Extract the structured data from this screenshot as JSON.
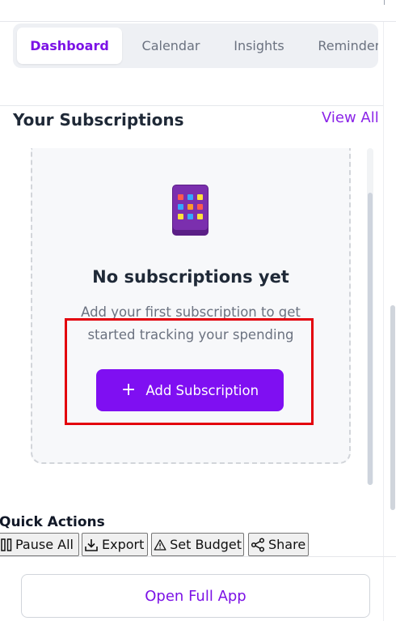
{
  "tabs": [
    {
      "label": "Dashboard",
      "active": true
    },
    {
      "label": "Calendar",
      "active": false
    },
    {
      "label": "Insights",
      "active": false
    },
    {
      "label": "Reminders",
      "active": false
    }
  ],
  "subscriptions": {
    "title": "Your Subscriptions",
    "view_all_label": "View All",
    "empty_icon": "mobile-apps-icon",
    "empty_title": "No subscriptions yet",
    "empty_description": "Add your first subscription to get started tracking your spending",
    "add_button_label": "Add Subscription",
    "add_button_icon": "plus-icon"
  },
  "quick_actions": {
    "title": "Quick Actions",
    "buttons": [
      {
        "label": "Pause All",
        "icon": "pause-icon"
      },
      {
        "label": "Export",
        "icon": "download-icon"
      },
      {
        "label": "Set Budget",
        "icon": "warning-icon"
      },
      {
        "label": "Share",
        "icon": "share-icon"
      }
    ]
  },
  "footer": {
    "open_app_label": "Open Full App"
  },
  "colors": {
    "accent": "#7f0ff2",
    "accent_text": "#7c12e6",
    "highlight": "#e3000b"
  }
}
